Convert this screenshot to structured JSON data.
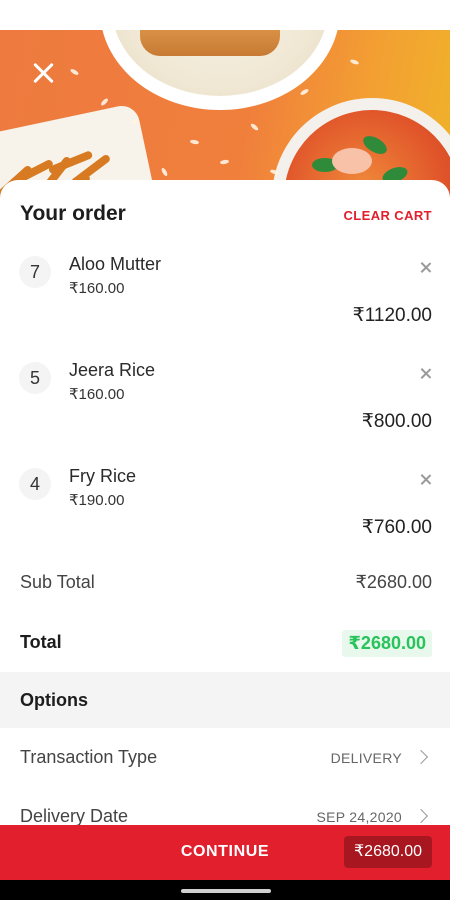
{
  "header": {
    "close_icon": "close-icon"
  },
  "order": {
    "title": "Your order",
    "clear_cart_label": "CLEAR CART",
    "items": [
      {
        "qty": "7",
        "name": "Aloo Mutter",
        "unit_price": "₹160.00",
        "line_total": "₹1120.00"
      },
      {
        "qty": "5",
        "name": "Jeera Rice",
        "unit_price": "₹160.00",
        "line_total": "₹800.00"
      },
      {
        "qty": "4",
        "name": "Fry Rice",
        "unit_price": "₹190.00",
        "line_total": "₹760.00"
      }
    ],
    "subtotal_label": "Sub Total",
    "subtotal_value": "₹2680.00",
    "total_label": "Total",
    "total_value": "₹2680.00"
  },
  "options": {
    "title": "Options",
    "rows": [
      {
        "label": "Transaction Type",
        "value": "DELIVERY"
      },
      {
        "label": "Delivery Date",
        "value": "SEP 24,2020"
      }
    ]
  },
  "footer": {
    "continue_label": "CONTINUE",
    "price": "₹2680.00"
  },
  "colors": {
    "accent": "#e2202d",
    "total_green": "#28c35a"
  }
}
